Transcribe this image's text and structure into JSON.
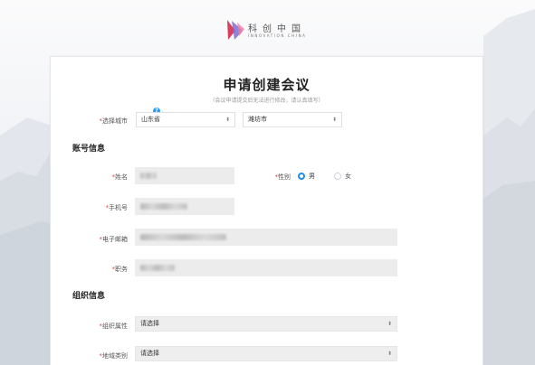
{
  "header": {
    "logo_cn": "科创中国",
    "logo_en": "INNOVATION CHINA"
  },
  "form": {
    "title": "申请创建会议",
    "subtitle": "（会议申请提交后无法进行修改，请认真填写）",
    "help_badge": "?",
    "required_mark": "*",
    "city": {
      "label": "选择城市",
      "province": "山东省",
      "city": "潍坊市"
    },
    "account_section": "账号信息",
    "name": {
      "label": "姓名"
    },
    "gender": {
      "label": "性别",
      "options": [
        "男",
        "女"
      ],
      "selected": "男"
    },
    "phone": {
      "label": "手机号"
    },
    "email": {
      "label": "电子邮箱"
    },
    "position": {
      "label": "职务"
    },
    "org_section": "组织信息",
    "org_type": {
      "label": "组织属性",
      "value": "请选择"
    },
    "region_type": {
      "label": "地域类别",
      "value": "请选择"
    }
  },
  "colors": {
    "accent": "#1e8ff0",
    "required": "#e53e3e",
    "input_bg": "#ececec"
  }
}
